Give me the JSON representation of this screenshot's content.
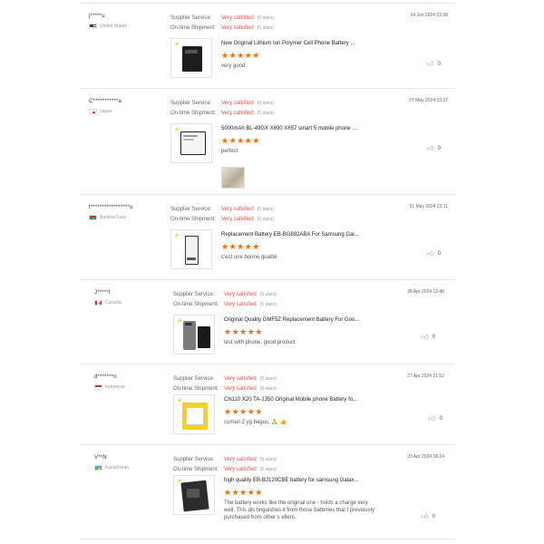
{
  "labels": {
    "supplier_service": "Supplier Service:",
    "ontime_shipment": "On-time Shipment:",
    "satisfied": "Very satisfied",
    "stars_note": "(5 stars)",
    "star_glyphs": "★★★★★"
  },
  "reviews": [
    {
      "user": "j*****u",
      "country": "United States",
      "date": "04 Jun 2024 03:38",
      "product": "New Original Lithium Ion Polymer Cell Phone Battery ...",
      "text": "very good",
      "likes": "0",
      "icon": "battery-black-icon"
    },
    {
      "user": "C***********a",
      "country": "Japan",
      "date": "07 May 2024 03:37",
      "product": "5000mAh BL-49GX X690 X657 smart 5 mobile phone ...",
      "text": "perfect",
      "likes": "0",
      "icon": "battery-white-icon"
    },
    {
      "user": "t*****************u",
      "country": "Burkina Faso",
      "date": "01 May 2024 23:11",
      "product": "Replacement Battery EB-BG892ABA For Samsung Gal...",
      "text": "c'est une bonne qualité",
      "likes": "0",
      "icon": "battery-slim-icon"
    },
    {
      "user": "J*****l",
      "country": "Canada",
      "date": "28 Apr 2024 12:48",
      "product": "Original Quality GMF5Z Replacement Battery For Goo...",
      "text": "test with phone, good product",
      "likes": "0",
      "icon": "phone-battery-icon"
    },
    {
      "user": "d*******n",
      "country": "Indonesia",
      "date": "27 Apr 2024 21:52",
      "product": "CN110 X20 TA-1350 Original Mobile phone Battery fo...",
      "text": "cuman 2 yg bagus, 🙏 👍",
      "likes": "0",
      "icon": "battery-yellow-icon"
    },
    {
      "user": "V**N",
      "country": "Kazakhstan",
      "date": "23 Apr 2024 18:24",
      "product": "high quality EB-BJ120CBE battery for samsung Galax...",
      "text": "The battery works like the original one - holds a charge very well.  This dis tinguishes it from those batteries that I previously purchased from other s ellers.",
      "likes": "0",
      "icon": "battery-dark-icon"
    }
  ]
}
